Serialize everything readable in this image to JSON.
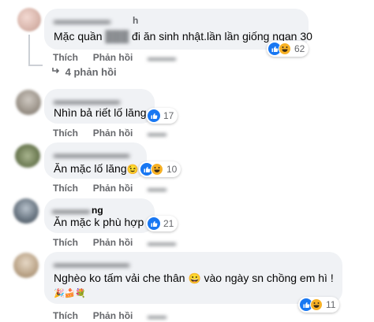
{
  "actions": {
    "like": "Thích",
    "reply": "Phản hồi"
  },
  "comments": [
    {
      "name_suffix": "h",
      "text_before": "Mặc quần",
      "text_after": "đi ăn sinh nhật.lần lần giống ngan 30",
      "reactions": "62",
      "replies": "4 phản hồi"
    },
    {
      "text": "Nhìn bả riết lố lăng",
      "reactions": "17"
    },
    {
      "text": "Ăn mặc lố lăng",
      "emoji": "😉",
      "reactions": "10"
    },
    {
      "name_suffix": "ng",
      "text": "Ăn mặc k phù hợp",
      "reactions": "21"
    },
    {
      "text": "Nghèo ko tấm vải che thân",
      "emoji": "😀",
      "text_after": "vào ngày sn chồng em hì !",
      "emoji_line": "🎉🍰💐",
      "reactions": "11"
    }
  ],
  "colors": {
    "like": "#1877f2",
    "haha": "#f7b125",
    "bubble": "#f0f2f5",
    "meta": "#65676b"
  },
  "icons": [
    "like-icon",
    "haha-icon",
    "reply-arrow-icon"
  ]
}
